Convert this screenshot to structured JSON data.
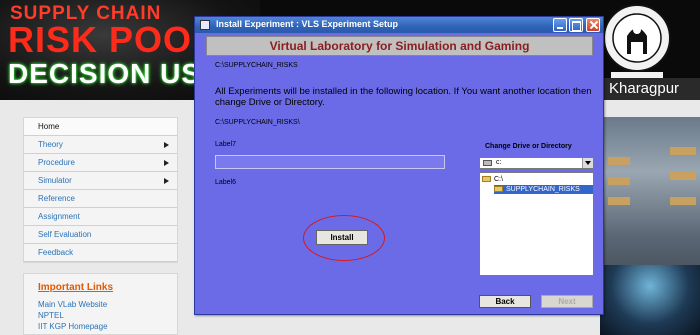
{
  "website": {
    "banner": {
      "title_line1": "SUPPLY CHAIN",
      "title_line2": "RISK POOL",
      "title_line3": "DECISION USING",
      "institute_text": "Kharagpur"
    },
    "sidebar": {
      "items": [
        {
          "label": "Home",
          "has_arrow": false
        },
        {
          "label": "Theory",
          "has_arrow": true
        },
        {
          "label": "Procedure",
          "has_arrow": true
        },
        {
          "label": "Simulator",
          "has_arrow": true
        },
        {
          "label": "Reference",
          "has_arrow": false
        },
        {
          "label": "Assignment",
          "has_arrow": false
        },
        {
          "label": "Self Evaluation",
          "has_arrow": false
        },
        {
          "label": "Feedback",
          "has_arrow": false
        }
      ]
    },
    "important_links": {
      "heading": "Important Links",
      "links": [
        "Main VLab Website",
        "NPTEL",
        "IIT KGP Homepage"
      ]
    }
  },
  "dialog": {
    "title": "Install Experiment  : VLS Experiment Setup",
    "header": "Virtual Laboratory for Simulation and Gaming",
    "source_path": "C:\\SUPPLYCHAIN_RISKS",
    "message": "All Experiments will be installed in the following location. If You want another location then change Drive or Directory.",
    "target_path": "C:\\SUPPLYCHAIN_RISKS\\",
    "label7": "Label7",
    "label6": "Label6",
    "input_value": "",
    "install_label": "Install",
    "change_drive_label": "Change Drive or Directory",
    "drive": "c:",
    "directories": [
      "C:\\",
      "SUPPLYCHAIN_RISKS"
    ],
    "selected_directory": "SUPPLYCHAIN_RISKS",
    "back_label": "Back",
    "next_label": "Next",
    "next_enabled": false
  },
  "colors": {
    "dialog_bg": "#6b6be8",
    "titlebar": "#2f63b8",
    "header_text": "#8a1e1e",
    "highlight_circle": "#d81818",
    "banner_red": "#ff2b1a"
  },
  "icons": [
    "window-app-icon",
    "minimize-icon",
    "maximize-icon",
    "close-icon",
    "drive-icon",
    "folder-icon",
    "institute-logo",
    "dropdown-arrow-icon"
  ]
}
